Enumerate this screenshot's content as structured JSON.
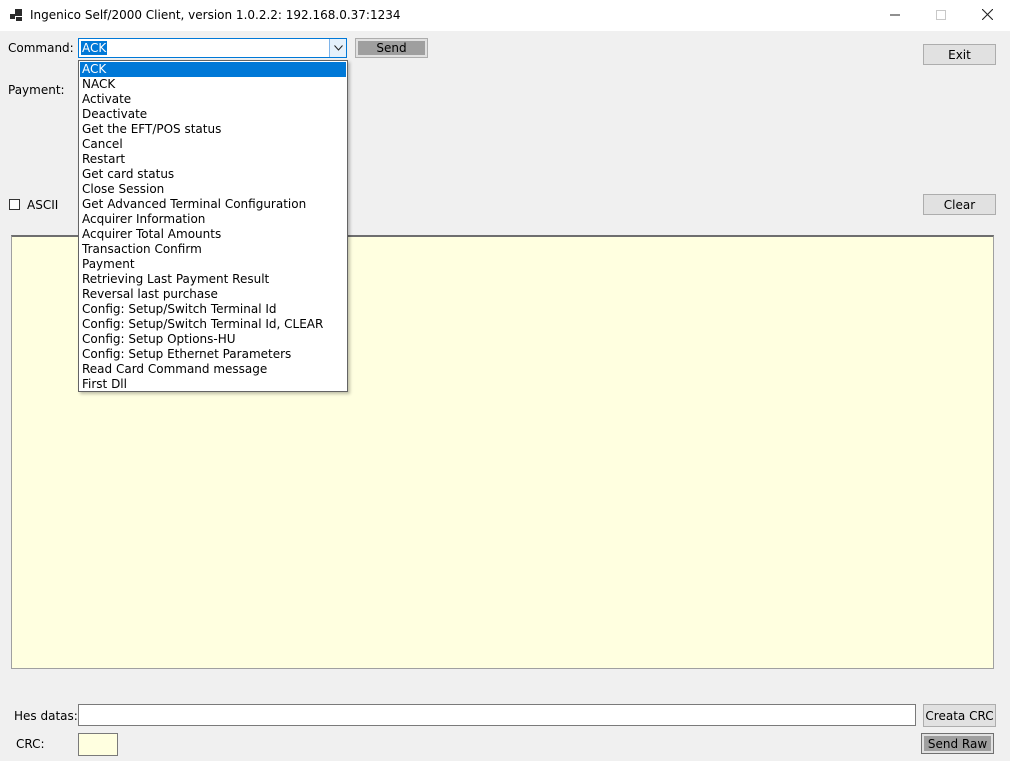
{
  "window": {
    "title": "Ingenico Self/2000 Client, version 1.0.2.2: 192.168.0.37:1234",
    "minimize": "—",
    "maximize": "☐",
    "close": "✕"
  },
  "command": {
    "label": "Command:",
    "selected": "ACK",
    "options": [
      "ACK",
      "NACK",
      "Activate",
      "Deactivate",
      "Get the EFT/POS status",
      "Cancel",
      "Restart",
      "Get card status",
      "Close Session",
      "Get Advanced Terminal Configuration",
      "Acquirer Information",
      "Acquirer Total Amounts",
      "Transaction Confirm",
      "Payment",
      "Retrieving Last Payment Result",
      "Reversal last purchase",
      "Config: Setup/Switch Terminal Id",
      "Config: Setup/Switch Terminal Id, CLEAR",
      "Config: Setup Options-HU",
      "Config: Setup Ethernet Parameters",
      "Read Card Command message",
      "First Dll"
    ]
  },
  "buttons": {
    "send": "Send",
    "exit": "Exit",
    "clear": "Clear",
    "create_crc": "Creata CRC",
    "send_raw": "Send Raw"
  },
  "payment": {
    "label": "Payment:"
  },
  "ascii": {
    "label": "ASCII",
    "checked": false
  },
  "hex": {
    "label": "Hes datas:",
    "value": ""
  },
  "crc": {
    "label": "CRC:",
    "value": ""
  },
  "colors": {
    "selection": "#0078d7",
    "log_background": "#ffffe0",
    "window_background": "#f0f0f0"
  }
}
